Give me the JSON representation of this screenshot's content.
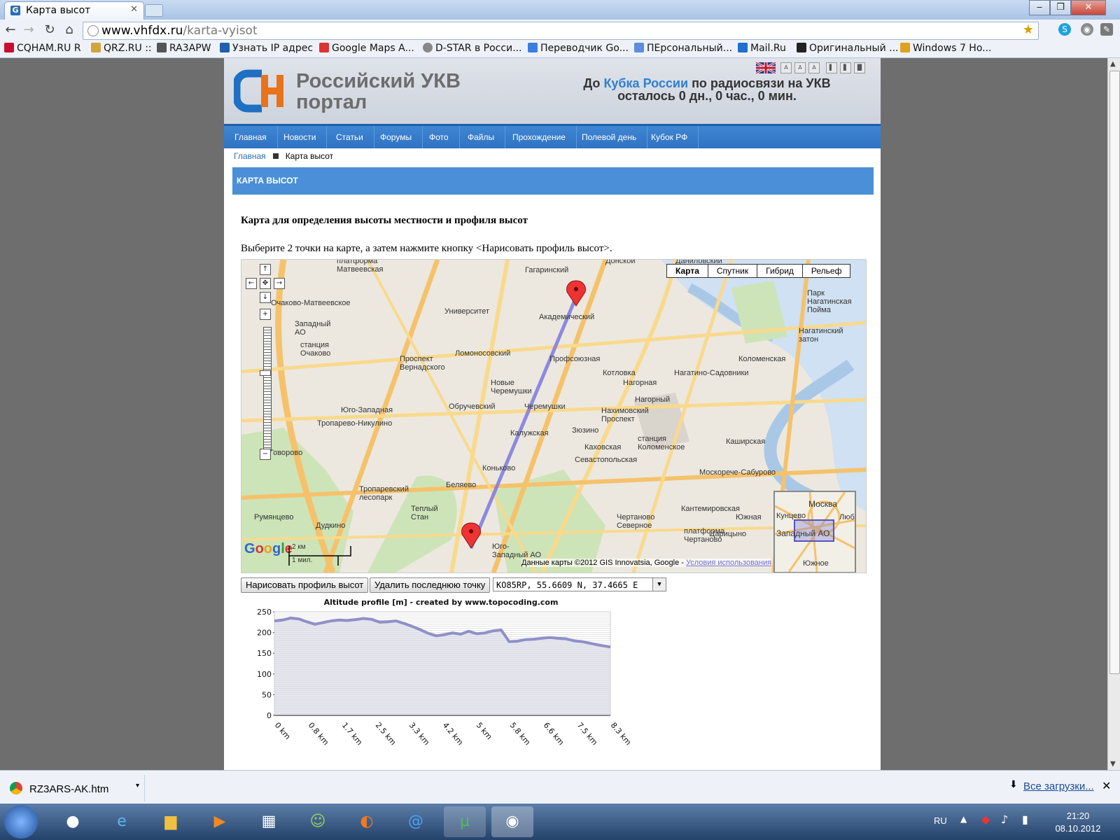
{
  "browser": {
    "tab_title": "Карта высот",
    "url_host": "www.vhfdx.ru",
    "url_path": "/karta-vyisot",
    "bookmarks": [
      "CQHAM.RU R",
      "QRZ.RU ::",
      "RA3APW",
      "Узнать IP адрес",
      "Google Maps A...",
      "D-STAR в Росси...",
      "Переводчик Go...",
      "ПЕрсональный...",
      "Mail.Ru",
      "Оригинальный ...",
      "Windows 7 Ho..."
    ]
  },
  "header": {
    "site_name_line1": "Российский УКВ",
    "site_name_line2": "портал",
    "cup_prefix": "До",
    "cup_link": "Кубка России",
    "cup_suffix": "по радиосвязи на УКВ",
    "cup_countdown": "осталось 0 дн., 0 час., 0 мин.",
    "accent_color": "#2f7fd0",
    "font_buttons": [
      "A",
      "A",
      "A"
    ]
  },
  "menu": [
    "Главная",
    "Новости",
    "Статьи",
    "Форумы",
    "Фото",
    "Файлы",
    "Прохождение",
    "Полевой день",
    "Кубок РФ"
  ],
  "breadcrumb": {
    "home": "Главная",
    "current": "Карта высот"
  },
  "content": {
    "section_title": "КАРТА ВЫСОТ",
    "heading": "Карта для определения высоты местности и профиля высот",
    "instruction": "Выберите 2 точки на карте, а затем нажмите кнопку <Нарисовать профиль высот>."
  },
  "map": {
    "types": [
      "Карта",
      "Спутник",
      "Гибрид",
      "Рельеф"
    ],
    "selected_type": "Карта",
    "labels": [
      "Даниловский",
      "Донской",
      "Гагаринский",
      "Академический",
      "Университет",
      "Очаково-Матвеевское",
      "Западный АО",
      "станция Очаково",
      "Проспект Вернадского",
      "Ломоносовский",
      "Профсоюзная",
      "Котловка",
      "Нагорная",
      "Нагатино-Садовники",
      "Новые Черемушки",
      "Черемушки",
      "Обручевский",
      "Юго-Западная",
      "Тропарево-Никулино",
      "Калужская",
      "Зюзино",
      "Нагорный",
      "Нахимовский Проспект",
      "Каховская",
      "станция Коломенское",
      "Севастопольская",
      "Коньково",
      "Беляево",
      "Тропаревский лесопарк",
      "Теплый Стан",
      "Румянцево",
      "Говорово",
      "Дудкино",
      "Юго-Западный АО",
      "Чертаново Северное",
      "Кантемировская",
      "Царицыно",
      "платформа Чертаново",
      "Южная",
      "Москорече-Сабурово",
      "Коломенская",
      "Каширская",
      "Нагатинский затон",
      "Парк Нагатинская Пойма",
      "платформа Матвеевская"
    ],
    "google": "Google",
    "scale_km": "2 км",
    "scale_mi": "1 мил.",
    "copyright": "Данные карты ©2012 GIS Innovatsia, Google -",
    "terms": "Условия использования",
    "minimap_labels": [
      "Москва",
      "Кунцево",
      "Западный АО",
      "Люб",
      "Южное"
    ],
    "route_color": "#7b78e0"
  },
  "controls": {
    "draw_button": "Нарисовать профиль высот",
    "delete_button": "Удалить последнюю точку",
    "coords_value": "KO85RP, 55.6609 N, 37.4665 E"
  },
  "chart_data": {
    "type": "area",
    "title": "Altitude profile [m] - created by www.topocoding.com",
    "xlabel": "",
    "ylabel": "",
    "ylim": [
      0,
      250
    ],
    "yticks": [
      0,
      50,
      100,
      150,
      200,
      250
    ],
    "xtick_labels": [
      "0 km",
      "0.8 km",
      "1.7 km",
      "2.5 km",
      "3.3 km",
      "4.2 km",
      "5 km",
      "5.8 km",
      "6.6 km",
      "7.5 km",
      "8.3 km"
    ],
    "x": [
      0,
      0.2,
      0.4,
      0.6,
      0.8,
      1.0,
      1.2,
      1.4,
      1.6,
      1.8,
      2.0,
      2.2,
      2.4,
      2.6,
      2.8,
      3.0,
      3.2,
      3.4,
      3.6,
      3.8,
      4.0,
      4.2,
      4.4,
      4.6,
      4.8,
      5.0,
      5.2,
      5.4,
      5.6,
      5.8,
      6.0,
      6.2,
      6.4,
      6.6,
      6.8,
      7.0,
      7.2,
      7.4,
      7.6,
      7.8,
      8.0,
      8.3
    ],
    "values": [
      228,
      230,
      235,
      233,
      226,
      220,
      224,
      228,
      230,
      229,
      231,
      234,
      232,
      225,
      226,
      228,
      222,
      215,
      207,
      198,
      192,
      195,
      199,
      196,
      203,
      197,
      199,
      204,
      206,
      178,
      179,
      183,
      184,
      186,
      188,
      186,
      185,
      180,
      178,
      174,
      170,
      165
    ],
    "grid": true,
    "fill_color": "#d4d4e4",
    "line_color": "#8f8fc9"
  },
  "downloads": {
    "file": "RZ3ARS-AK.htm",
    "all_link": "Все загрузки..."
  },
  "taskbar": {
    "lang": "RU",
    "time": "21:20",
    "date": "08.10.2012"
  }
}
